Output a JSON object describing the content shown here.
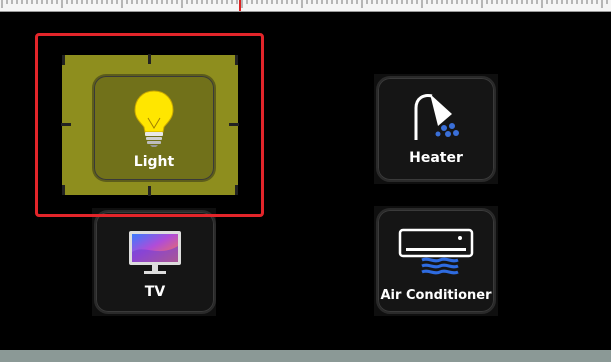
{
  "devices": [
    {
      "label": "Light",
      "icon": "lightbulb-icon",
      "selected": true
    },
    {
      "label": "Heater",
      "icon": "shower-heater-icon",
      "selected": false
    },
    {
      "label": "TV",
      "icon": "tv-icon",
      "selected": false
    },
    {
      "label": "Air Conditioner",
      "icon": "air-conditioner-icon",
      "selected": false
    }
  ],
  "colors": {
    "selection_fill": "#bebe28",
    "highlight_frame": "#e3252a",
    "canvas_background": "#000000"
  }
}
